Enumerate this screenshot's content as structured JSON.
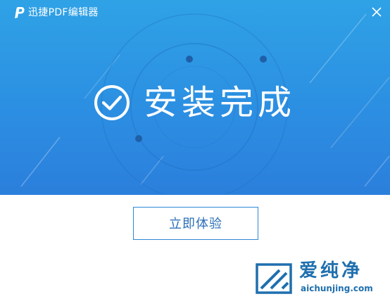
{
  "titlebar": {
    "app_title": "迅捷PDF编辑器",
    "logo_icon": "pdf-p-logo-icon",
    "close_icon": "close-icon"
  },
  "hero": {
    "status_text": "安装完成",
    "status_icon": "check-circle-icon"
  },
  "actions": {
    "start_label": "立即体验"
  },
  "watermark": {
    "title": "爱纯净",
    "url": "aichunjing.com",
    "logo_icon": "square-logo-icon"
  },
  "colors": {
    "banner_top": "#2fa2e6",
    "banner_bottom": "#2b7fdc",
    "button_border": "#2d88d6",
    "button_text": "#2b6fb8",
    "watermark": "#1f6fae"
  }
}
